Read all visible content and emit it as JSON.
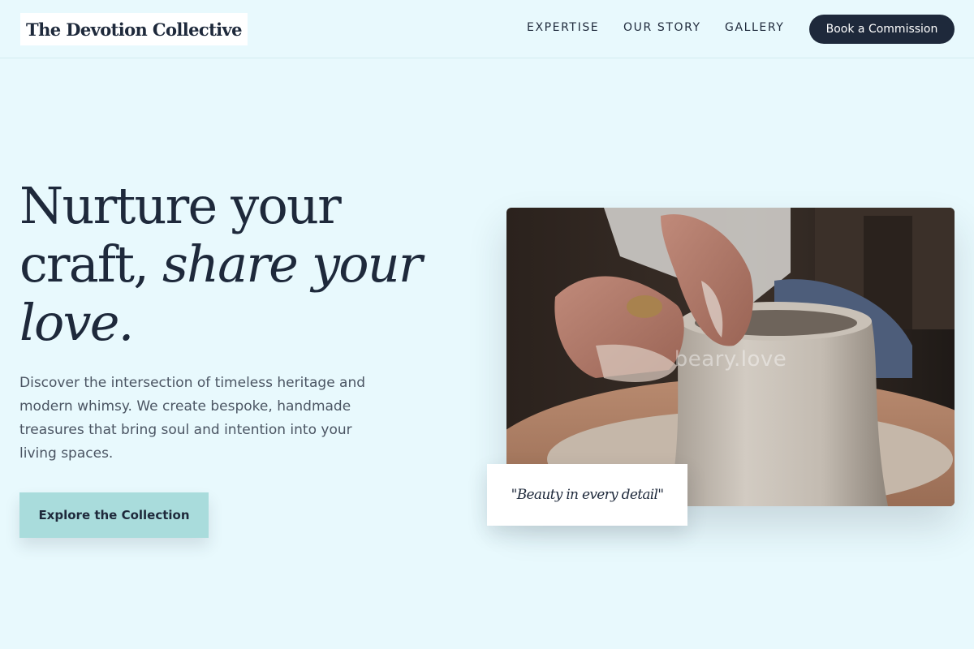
{
  "brand": {
    "name": "The Devotion Collective"
  },
  "nav": {
    "links": [
      "EXPERTISE",
      "OUR STORY",
      "GALLERY"
    ],
    "cta_label": "Book a Commission"
  },
  "hero": {
    "headline_line1": "Nurture your",
    "headline_line2_plain": "craft, ",
    "headline_line2_italic": "share your",
    "headline_line3_italic": "love.",
    "description": "Discover the intersection of timeless heritage and modern whimsy. We create bespoke, handmade treasures that bring soul and intention into your living spaces.",
    "cta_label": "Explore the Collection"
  },
  "image": {
    "subject": "hands shaping a clay pot on a pottery wheel",
    "watermark": "beary.love",
    "quote": "\"Beauty in every detail\""
  },
  "colors": {
    "background": "#e8f9fd",
    "ink": "#1e293b",
    "accent": "#a9dcdc",
    "body_text": "#4b5563"
  }
}
